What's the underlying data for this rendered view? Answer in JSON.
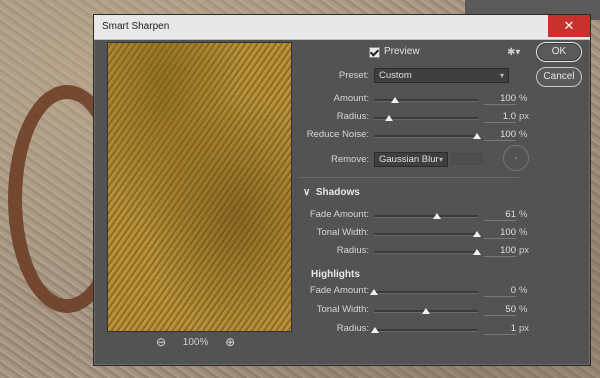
{
  "window": {
    "title": "Smart Sharpen",
    "close_glyph": "✕"
  },
  "preview": {
    "checked": true,
    "label": "Preview",
    "zoom_level": "100%"
  },
  "buttons": {
    "ok": "OK",
    "cancel": "Cancel"
  },
  "preset": {
    "label": "Preset:",
    "value": "Custom"
  },
  "main": [
    {
      "label": "Amount:",
      "value": "100",
      "unit": "%",
      "level": 0.2
    },
    {
      "label": "Radius:",
      "value": "1.0",
      "unit": "px",
      "level": 0.14
    },
    {
      "label": "Reduce Noise:",
      "value": "100",
      "unit": "%",
      "level": 0.99
    }
  ],
  "remove": {
    "label": "Remove:",
    "value": "Gaussian Blur"
  },
  "shadows": {
    "title": "Shadows",
    "rows": [
      {
        "label": "Fade Amount:",
        "value": "61",
        "unit": "%",
        "level": 0.61
      },
      {
        "label": "Tonal Width:",
        "value": "100",
        "unit": "%",
        "level": 0.99
      },
      {
        "label": "Radius:",
        "value": "100",
        "unit": "px",
        "level": 0.99
      }
    ]
  },
  "highlights": {
    "title": "Highlights",
    "rows": [
      {
        "label": "Fade Amount:",
        "value": "0",
        "unit": "%",
        "level": 0.0
      },
      {
        "label": "Tonal Width:",
        "value": "50",
        "unit": "%",
        "level": 0.5
      },
      {
        "label": "Radius:",
        "value": "1",
        "unit": "px",
        "level": 0.01
      }
    ]
  },
  "icons": {
    "gear": "gear-icon",
    "zoom_out": "zoom-out-icon",
    "zoom_in": "zoom-in-icon",
    "collapse": "chevron-down-icon"
  }
}
